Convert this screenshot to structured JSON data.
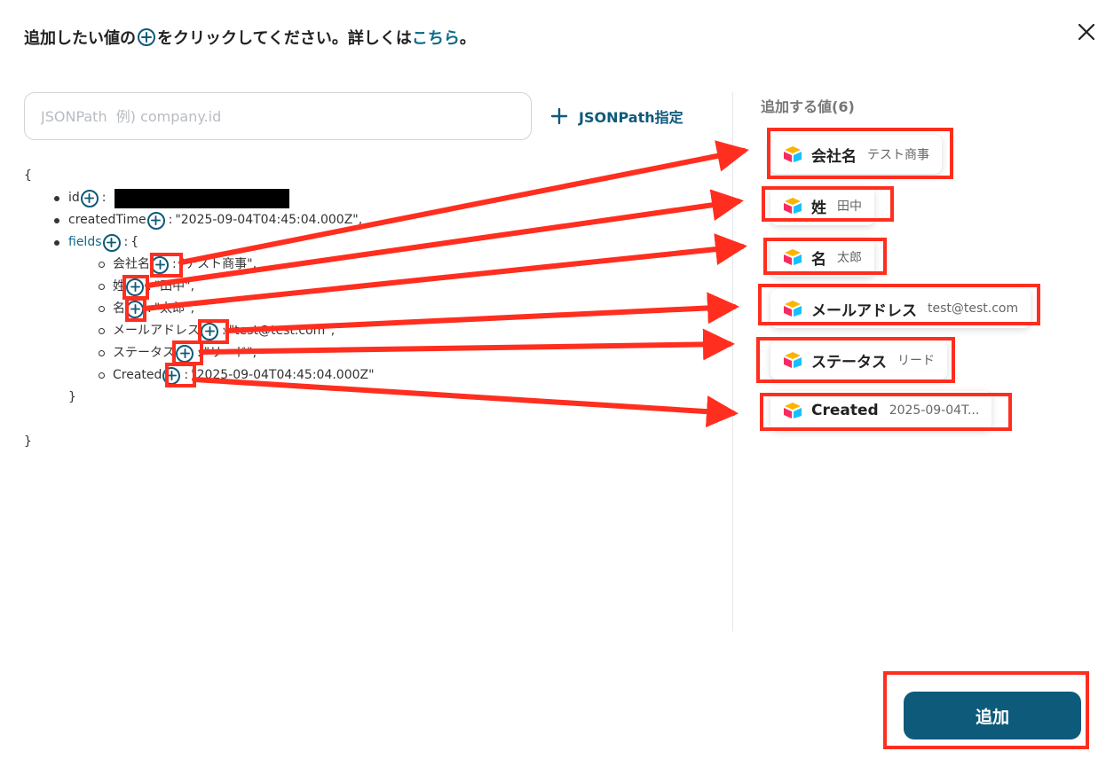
{
  "header": {
    "before": "追加したい値の",
    "after": "をクリックしてください。詳しくは",
    "link": "こちら",
    "end": "。"
  },
  "search": {
    "placeholder": "JSONPath  例) company.id",
    "value": ""
  },
  "jsonpath_button": {
    "label": "JSONPath指定"
  },
  "json_tree": {
    "open_brace": "{",
    "close_brace": "}",
    "inner_close": "}",
    "id_key": "id",
    "createdTime_key": "createdTime",
    "createdTime_value": "\"2025-09-04T04:45:04.000Z\",",
    "fields_key": "fields",
    "fields_open": "{",
    "fields": [
      {
        "key": "会社名",
        "value": "\"テスト商事\","
      },
      {
        "key": "姓",
        "value": "\"田中\","
      },
      {
        "key": "名",
        "value": "\"太郎\","
      },
      {
        "key": "メールアドレス",
        "value": "\"test@test.com\","
      },
      {
        "key": "ステータス",
        "value": "\"リード\","
      },
      {
        "key": "Created",
        "value": "\"2025-09-04T04:45:04.000Z\""
      }
    ]
  },
  "panel": {
    "title": "追加する値(6)",
    "items": [
      {
        "name": "会社名",
        "value": "テスト商事"
      },
      {
        "name": "姓",
        "value": "田中"
      },
      {
        "name": "名",
        "value": "太郎"
      },
      {
        "name": "メールアドレス",
        "value": "test@test.com"
      },
      {
        "name": "ステータス",
        "value": "リード"
      },
      {
        "name": "Created",
        "value": "2025-09-04T..."
      }
    ]
  },
  "add_button": {
    "label": "追加"
  },
  "colors": {
    "accent": "#0e5a7a",
    "link": "#0e6a8a",
    "annotation": "#ff2e1f"
  }
}
